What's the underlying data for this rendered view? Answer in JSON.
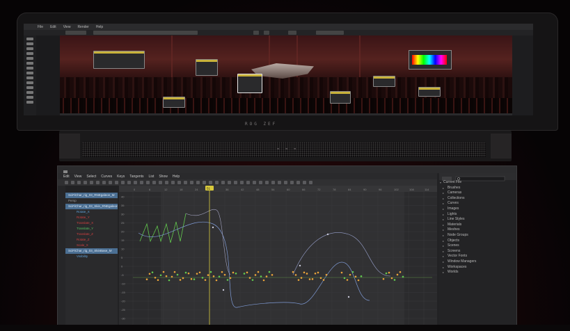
{
  "upper_app": {
    "menu": [
      "File",
      "Edit",
      "View",
      "Render",
      "Help"
    ],
    "brand": "ROG ZEF"
  },
  "lower_app": {
    "menu": [
      "Edit",
      "View",
      "Select",
      "Curves",
      "Keys",
      "Tangents",
      "List",
      "Show",
      "Help"
    ],
    "outliner": [
      {
        "label": "SciFiChar_rig_03_RNEgaleon_M",
        "style": "sel"
      },
      {
        "label": "Persp",
        "style": ""
      },
      {
        "label": "SciFiChar_rig_03_Skin_RNEgaleon_M",
        "style": "sel"
      },
      {
        "label": "Rotate_X",
        "style": "blue"
      },
      {
        "label": "Rotate_Y",
        "style": "red"
      },
      {
        "label": "Translate_X",
        "style": "red"
      },
      {
        "label": "Translate_Y",
        "style": "green"
      },
      {
        "label": "Translate_Z",
        "style": "red"
      },
      {
        "label": "Rotate_Z",
        "style": "red"
      },
      {
        "label": "Scale_X",
        "style": "red"
      },
      {
        "label": "SciFiChar_rig_03_SkinBase_M",
        "style": "sel"
      },
      {
        "label": "Visibility",
        "style": "blue"
      }
    ],
    "ruler_ticks": [
      "0",
      "6",
      "12",
      "18",
      "24",
      "30",
      "36",
      "42",
      "48",
      "54",
      "60",
      "66",
      "72",
      "78",
      "84",
      "90",
      "96",
      "102",
      "108",
      "114"
    ],
    "y_ticks": [
      "40",
      "35",
      "30",
      "25",
      "20",
      "15",
      "10",
      "5",
      "0",
      "-5",
      "-10",
      "-15",
      "-20",
      "-25",
      "-30",
      "-35"
    ],
    "current_frame": "51",
    "tree_root": "Current File",
    "tree_items": [
      "Brushes",
      "Cameras",
      "Collections",
      "Curves",
      "Images",
      "Lights",
      "Line Styles",
      "Materials",
      "Meshes",
      "Node Groups",
      "Objects",
      "Scenes",
      "Screens",
      "Vector Fonts",
      "Window Managers",
      "Workspaces",
      "Worlds"
    ]
  },
  "colors": {
    "accent_key": "#e8a33a",
    "curve_green": "#62c94e",
    "curve_blue": "#7f9bd6",
    "playhead": "#d8c93c",
    "selection": "#4b6f93"
  }
}
